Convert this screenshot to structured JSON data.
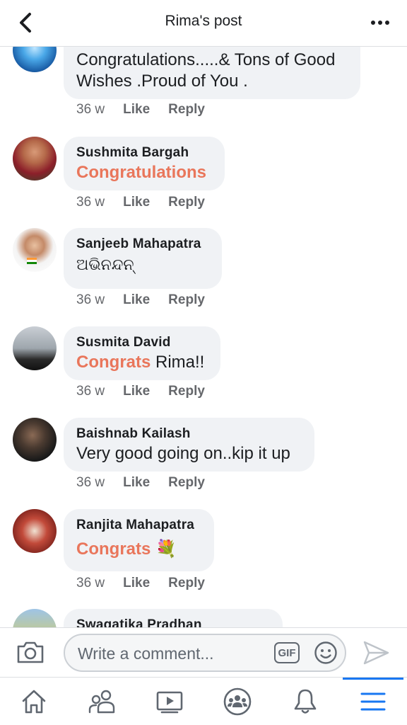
{
  "header": {
    "title": "Rima's post"
  },
  "composer": {
    "placeholder": "Write a comment...",
    "gif_label": "GIF"
  },
  "comments": [
    {
      "author": "",
      "text": "",
      "lines": [
        "Congratulations.....& Tons of Good",
        "Wishes .Proud of You ."
      ],
      "time": "36 w",
      "like": "Like",
      "reply": "Reply"
    },
    {
      "author": "Sushmita Bargah",
      "highlight": "Congratulations",
      "time": "36 w",
      "like": "Like",
      "reply": "Reply"
    },
    {
      "author": "Sanjeeb Mahapatra",
      "text": "ଅଭିନନ୍ଦନ୍",
      "time": "36 w",
      "like": "Like",
      "reply": "Reply"
    },
    {
      "author": "Susmita David",
      "highlight": "Congrats",
      "text": " Rima!!",
      "time": "36 w",
      "like": "Like",
      "reply": "Reply"
    },
    {
      "author": "Baishnab Kailash",
      "text": "Very good going on..kip it up",
      "time": "36 w",
      "like": "Like",
      "reply": "Reply"
    },
    {
      "author": "Ranjita Mahapatra",
      "highlight": "Congrats",
      "emoji": "💐",
      "time": "36 w",
      "like": "Like",
      "reply": "Reply"
    },
    {
      "author": "Swagatika Pradhan"
    }
  ],
  "colors": {
    "accent": "#1877f2",
    "highlight": "#e9765b",
    "bubble": "#f0f2f5",
    "meta": "#65676b"
  },
  "nav_icons": [
    "home-icon",
    "friends-icon",
    "watch-icon",
    "groups-icon",
    "notifications-icon",
    "menu-icon"
  ]
}
